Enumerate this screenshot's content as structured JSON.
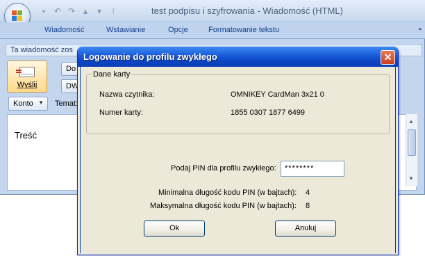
{
  "outlook": {
    "title": "test podpisu i szyfrowania - Wiadomość (HTML)",
    "ribbon_tabs": [
      "Wiadomość",
      "Wstawianie",
      "Opcje",
      "Formatowanie tekstu"
    ],
    "info_bar": "Ta wiadomość zos",
    "send_label": "Wyślij",
    "to_label": "Do",
    "cc_label": "DW",
    "account_label": "Konto",
    "subject_label": "Temat:",
    "body_text": "Treść"
  },
  "dialog": {
    "title": "Logowanie do profilu zwykłego",
    "close_glyph": "✕",
    "card_group_label": "Dane karty",
    "reader_label": "Nazwa czytnika:",
    "reader_value": "OMNIKEY CardMan 3x21 0",
    "card_number_label": "Numer karty:",
    "card_number_value": "1855 0307 1877 6499",
    "pin_label": "Podaj PIN dla profilu zwykłego:",
    "pin_value": "********",
    "min_label": "Minimalna długość kodu PIN (w bajtach):",
    "min_value": "4",
    "max_label": "Maksymalna długość kodu PIN (w bajtach):",
    "max_value": "8",
    "ok_label": "Ok",
    "cancel_label": "Anuluj"
  },
  "colors": {
    "dialog_title_bar": "#0c46c4",
    "dialog_body": "#ece9d8",
    "outlook_frame": "#c3d6ee"
  },
  "icons": {
    "office_button": "office-logo-icon",
    "save": "save-icon",
    "undo": "undo-icon",
    "redo": "redo-icon",
    "send": "envelope-icon",
    "close": "close-icon"
  }
}
